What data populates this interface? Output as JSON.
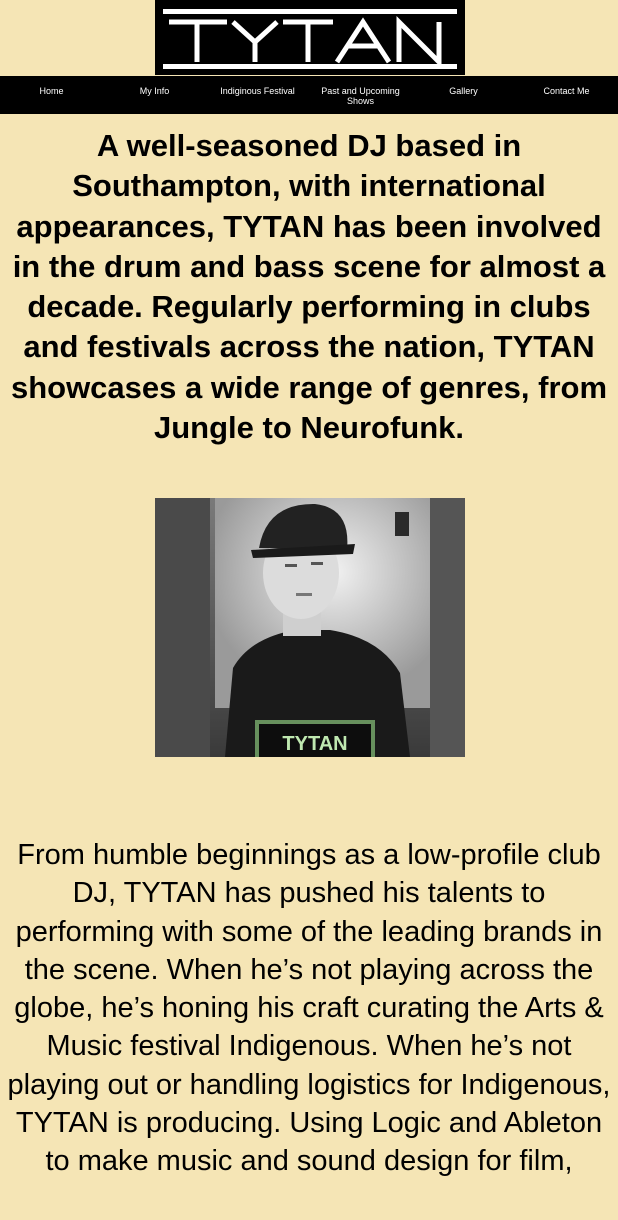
{
  "brand": {
    "logo_text": "TYTAN"
  },
  "nav": {
    "items": [
      {
        "label": "Home"
      },
      {
        "label": "My Info"
      },
      {
        "label": "Indiginous Festival"
      },
      {
        "label": "Past and Upcoming Shows"
      },
      {
        "label": "Gallery"
      },
      {
        "label": "Contact Me"
      }
    ]
  },
  "intro": {
    "headline": "A well-seasoned DJ based in Southampton, with international appearances, TYTAN has been involved in the drum and bass scene for almost a decade. Regularly performing in clubs and festivals across the nation, TYTAN showcases a wide range of genres, from Jungle to Neurofunk."
  },
  "photo": {
    "screen_logo_text": "TYTAN"
  },
  "bio": {
    "paragraph": "From humble beginnings as a low-profile club DJ, TYTAN has pushed his talents to performing with some of the leading brands in the scene. When he’s not playing across the globe, he’s honing his craft curating the Arts & Music festival Indigenous. When he’s not playing out or handling logistics for Indigenous, TYTAN is producing. Using Logic and Ableton to make music and sound design for film,"
  },
  "colors": {
    "page_background": "#f5e5b5",
    "nav_background": "#000000",
    "nav_text": "#ffffff",
    "screen_glow": "#9be08a"
  }
}
